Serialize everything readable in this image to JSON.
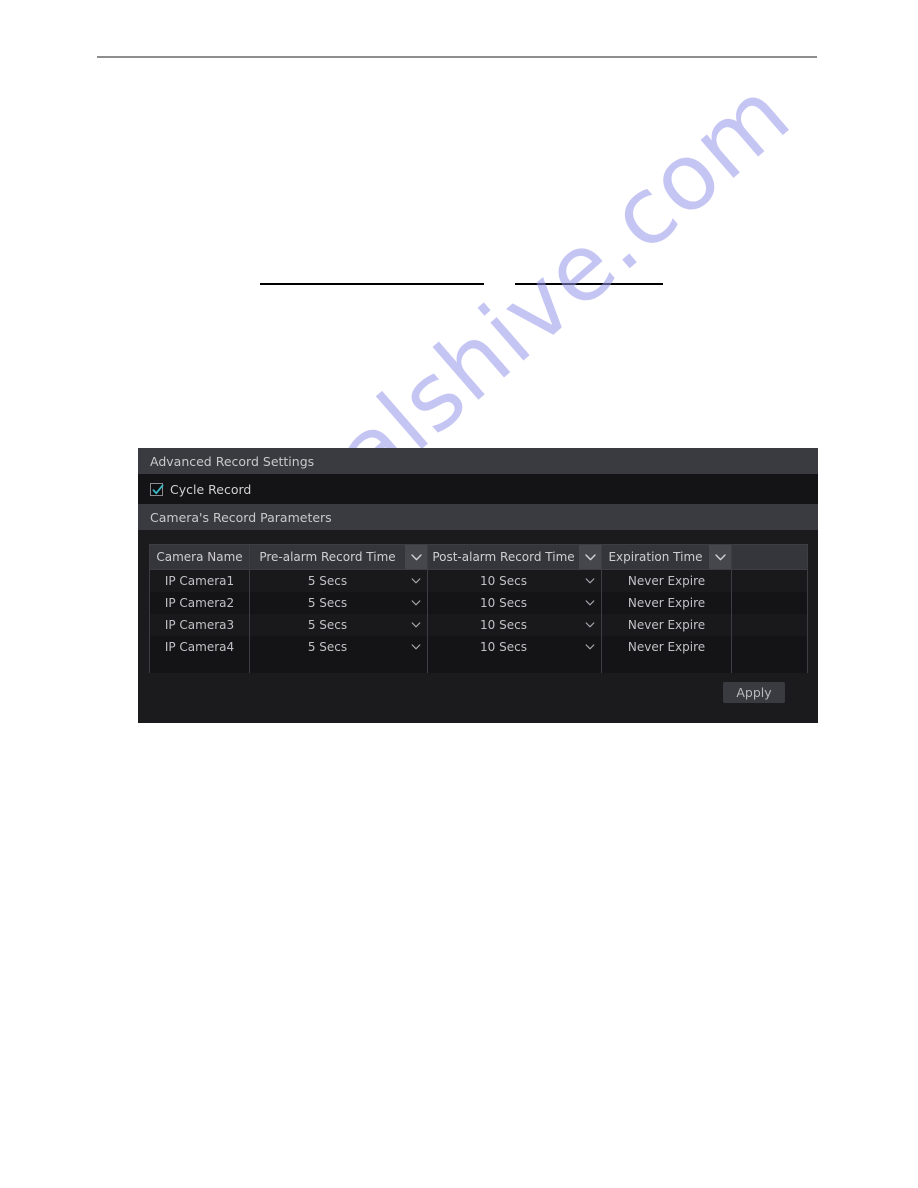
{
  "page": {
    "background_color": "#ffffff",
    "top_rule_color": "#8e8e8e",
    "redaction_line_color": "#000000",
    "watermark_text": "manualshive.com",
    "watermark_color": "#9696eb"
  },
  "dialog": {
    "title": "Advanced Record Settings",
    "background_color": "#1b1b1d",
    "header_color": "#3a3b40",
    "cycle_record": {
      "label": "Cycle Record",
      "checked": true,
      "check_color": "#3bb8c4"
    },
    "section_title": "Camera's Record Parameters",
    "table": {
      "columns": [
        {
          "label": "Camera Name",
          "has_header_dropdown": false,
          "has_row_dropdown": false
        },
        {
          "label": "Pre-alarm Record Time",
          "has_header_dropdown": true,
          "has_row_dropdown": true
        },
        {
          "label": "Post-alarm Record Time",
          "has_header_dropdown": true,
          "has_row_dropdown": true
        },
        {
          "label": "Expiration Time",
          "has_header_dropdown": true,
          "has_row_dropdown": false
        },
        {
          "label": "",
          "has_header_dropdown": false,
          "has_row_dropdown": false
        }
      ],
      "rows": [
        {
          "camera_name": "IP Camera1",
          "pre_alarm": "5 Secs",
          "post_alarm": "10 Secs",
          "expiration": "Never Expire",
          "extra": ""
        },
        {
          "camera_name": "IP Camera2",
          "pre_alarm": "5 Secs",
          "post_alarm": "10 Secs",
          "expiration": "Never Expire",
          "extra": ""
        },
        {
          "camera_name": "IP Camera3",
          "pre_alarm": "5 Secs",
          "post_alarm": "10 Secs",
          "expiration": "Never Expire",
          "extra": ""
        },
        {
          "camera_name": "IP Camera4",
          "pre_alarm": "5 Secs",
          "post_alarm": "10 Secs",
          "expiration": "Never Expire",
          "extra": ""
        }
      ]
    },
    "apply_label": "Apply"
  }
}
